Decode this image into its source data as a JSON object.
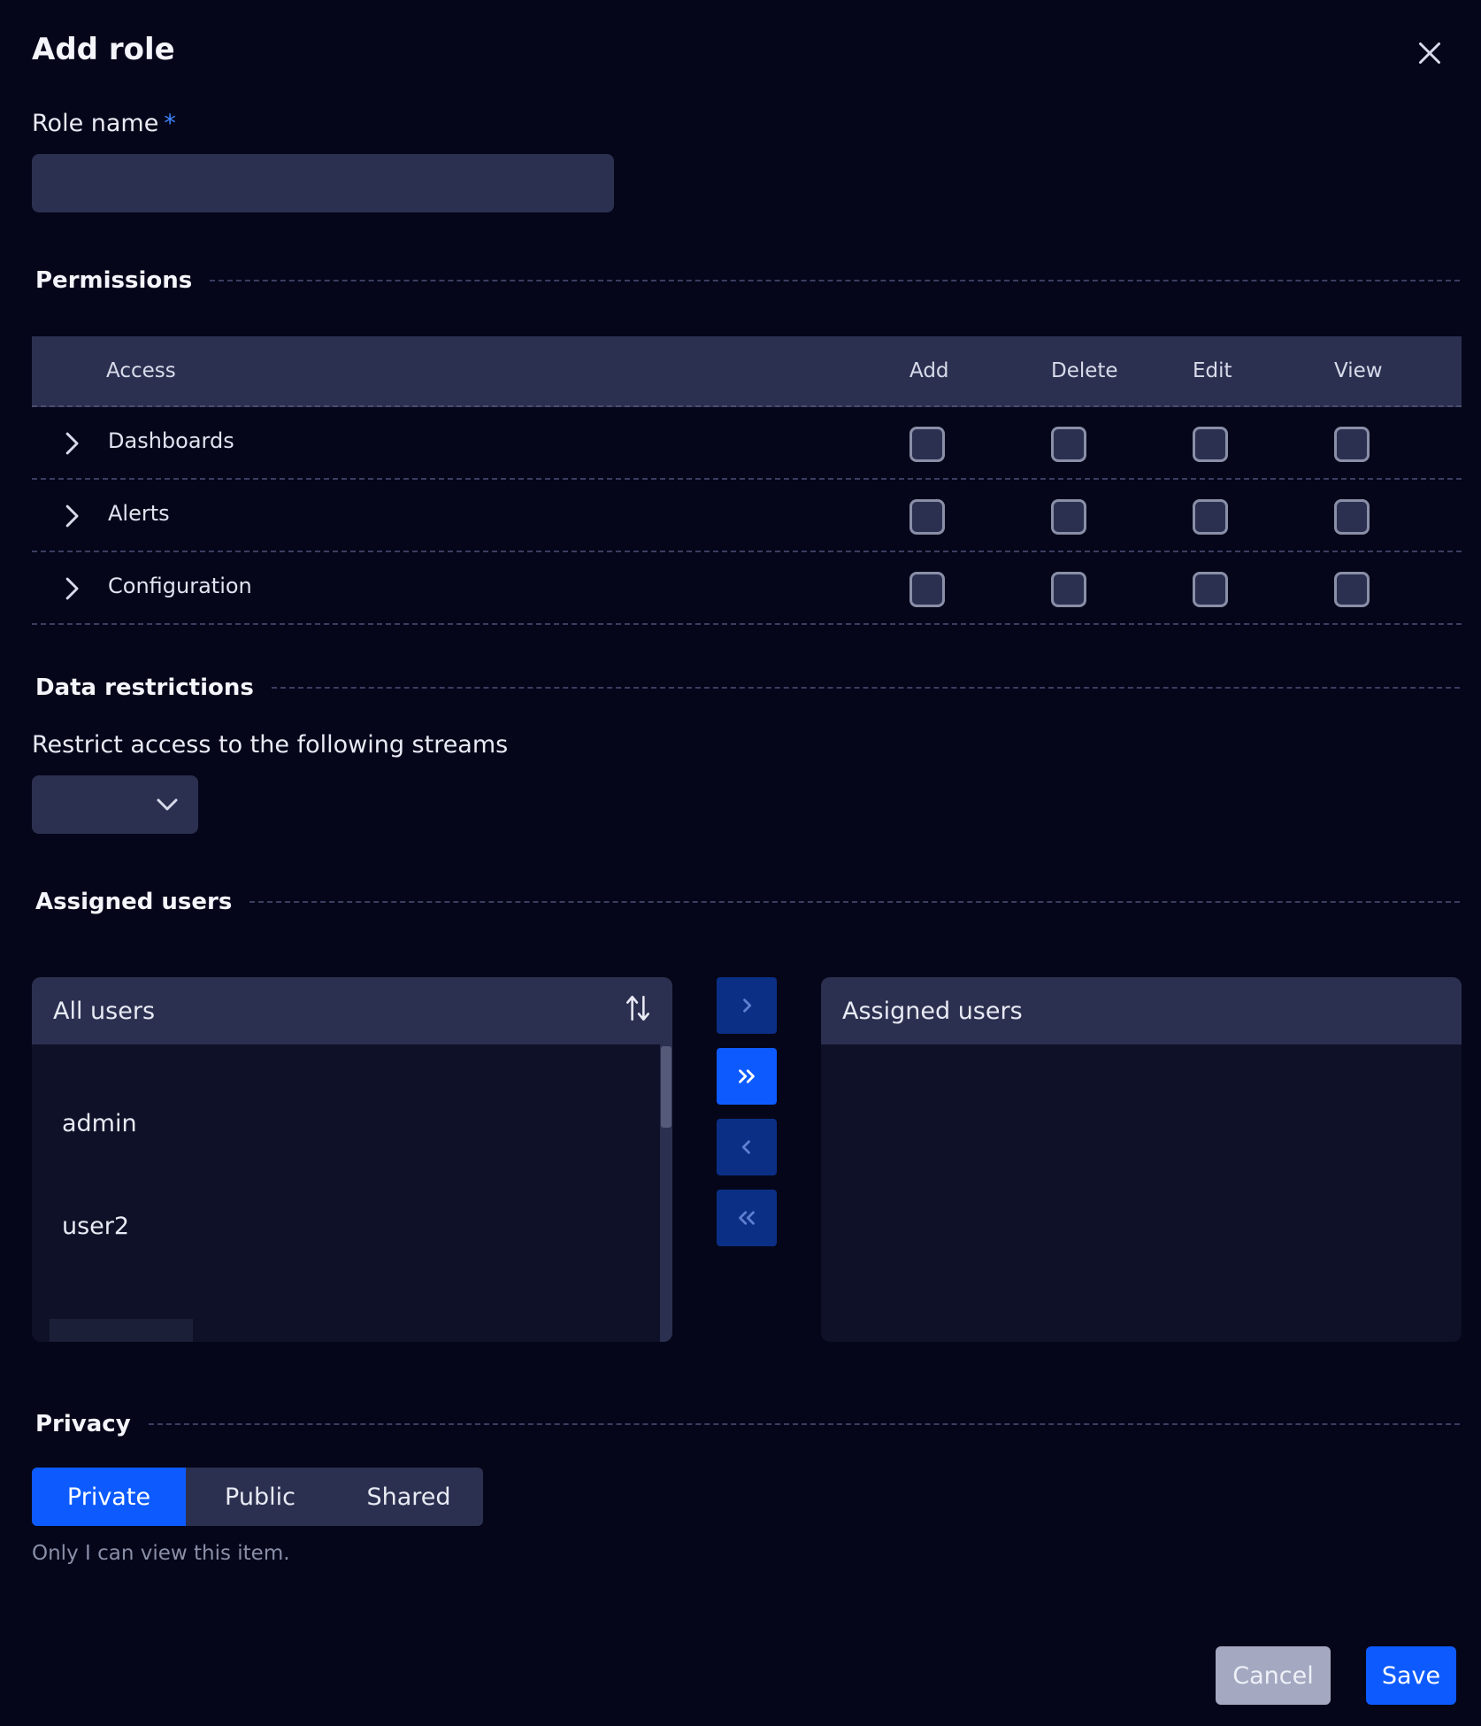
{
  "dialog": {
    "title": "Add role",
    "close_icon": "close-icon"
  },
  "role_name": {
    "label": "Role name",
    "required_mark": "*",
    "value": "",
    "placeholder": ""
  },
  "permissions": {
    "section_title": "Permissions",
    "columns": [
      "Access",
      "Add",
      "Delete",
      "Edit",
      "View"
    ],
    "rows": [
      {
        "label": "Dashboards",
        "add": false,
        "delete": false,
        "edit": false,
        "view": false
      },
      {
        "label": "Alerts",
        "add": false,
        "delete": false,
        "edit": false,
        "view": false
      },
      {
        "label": "Configuration",
        "add": false,
        "delete": false,
        "edit": false,
        "view": false
      }
    ]
  },
  "data_restrictions": {
    "section_title": "Data restrictions",
    "label": "Restrict access to the following streams",
    "selected": ""
  },
  "assigned_users": {
    "section_title": "Assigned users",
    "all_users_title": "All users",
    "assigned_title": "Assigned users",
    "all_users": [
      "admin",
      "user2"
    ],
    "assigned": []
  },
  "privacy": {
    "section_title": "Privacy",
    "options": [
      "Private",
      "Public",
      "Shared"
    ],
    "selected": "Private",
    "hint": "Only I can view this item."
  },
  "footer": {
    "cancel_label": "Cancel",
    "save_label": "Save"
  },
  "colors": {
    "background": "#05061a",
    "surface": "#2c3050",
    "accent": "#0d5bff",
    "accent_dim": "#0b2f85"
  }
}
